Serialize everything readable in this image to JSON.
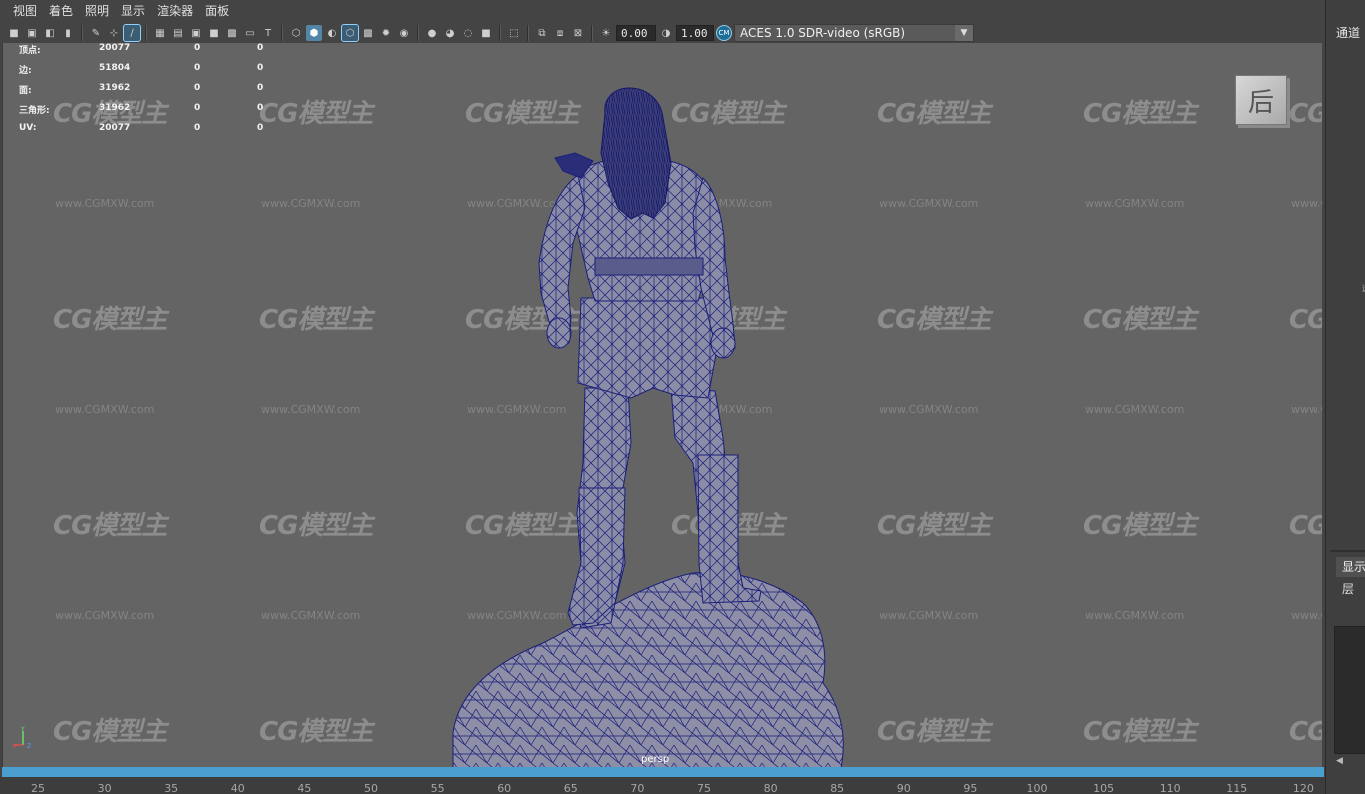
{
  "menubar": {
    "items": [
      "视图",
      "着色",
      "照明",
      "显示",
      "渲染器",
      "面板"
    ]
  },
  "toolbar": {
    "gamma_value": "0.00",
    "exposure_value": "1.00",
    "color_space": "ACES 1.0 SDR-video (sRGB)",
    "cm_badge": "CM",
    "icons": [
      "camera-icon",
      "camera-attributes-icon",
      "bookmark-icon",
      "image-plane-icon",
      "grease-pencil-icon",
      "2d-pan-zoom-icon",
      "grid-icon",
      "film-gate-icon",
      "resolution-gate-icon",
      "gate-mask-icon",
      "field-chart-icon",
      "safe-action-icon",
      "safe-title-icon",
      "wireframe-icon",
      "smooth-shade-icon",
      "default-material-icon",
      "wireframe-on-shaded-icon",
      "textured-icon",
      "use-lights-icon",
      "shadows-icon",
      "ambient-occlusion-icon",
      "motion-blur-icon",
      "anti-aliasing-icon",
      "depth-of-field-icon",
      "isolate-select-icon",
      "xray-icon",
      "xray-active-icon",
      "xray-joints-icon",
      "backface-culling-icon",
      "exposure-icon",
      "gamma-icon",
      "color-management-icon"
    ]
  },
  "viewport": {
    "camera": "persp",
    "view_cube_label": "后",
    "hud": [
      {
        "label": "顶点:",
        "v1": "20077",
        "v2": "0",
        "v3": "0"
      },
      {
        "label": "边:",
        "v1": "51804",
        "v2": "0",
        "v3": "0"
      },
      {
        "label": "面:",
        "v1": "31962",
        "v2": "0",
        "v3": "0"
      },
      {
        "label": "三角形:",
        "v1": "31962",
        "v2": "0",
        "v3": "0"
      },
      {
        "label": "UV:",
        "v1": "20077",
        "v2": "0",
        "v3": "0"
      }
    ],
    "watermark_logo": "CG模型主",
    "watermark_url": "www.CGMXW.com",
    "wire_color": "#1a1f7a",
    "mesh_fill": "#8a8aa0"
  },
  "timeline": {
    "bar_color": "#4a9fd0",
    "ticks": [
      "25",
      "30",
      "35",
      "40",
      "45",
      "50",
      "55",
      "60",
      "65",
      "70",
      "75",
      "80",
      "85",
      "90",
      "95",
      "100",
      "105",
      "110",
      "115",
      "120"
    ]
  },
  "right_panel": {
    "channel_tab": "通道",
    "display_tab": "显示",
    "layer_label": "层",
    "scroll_arrow": "◀",
    "edge_glyph": "选"
  }
}
